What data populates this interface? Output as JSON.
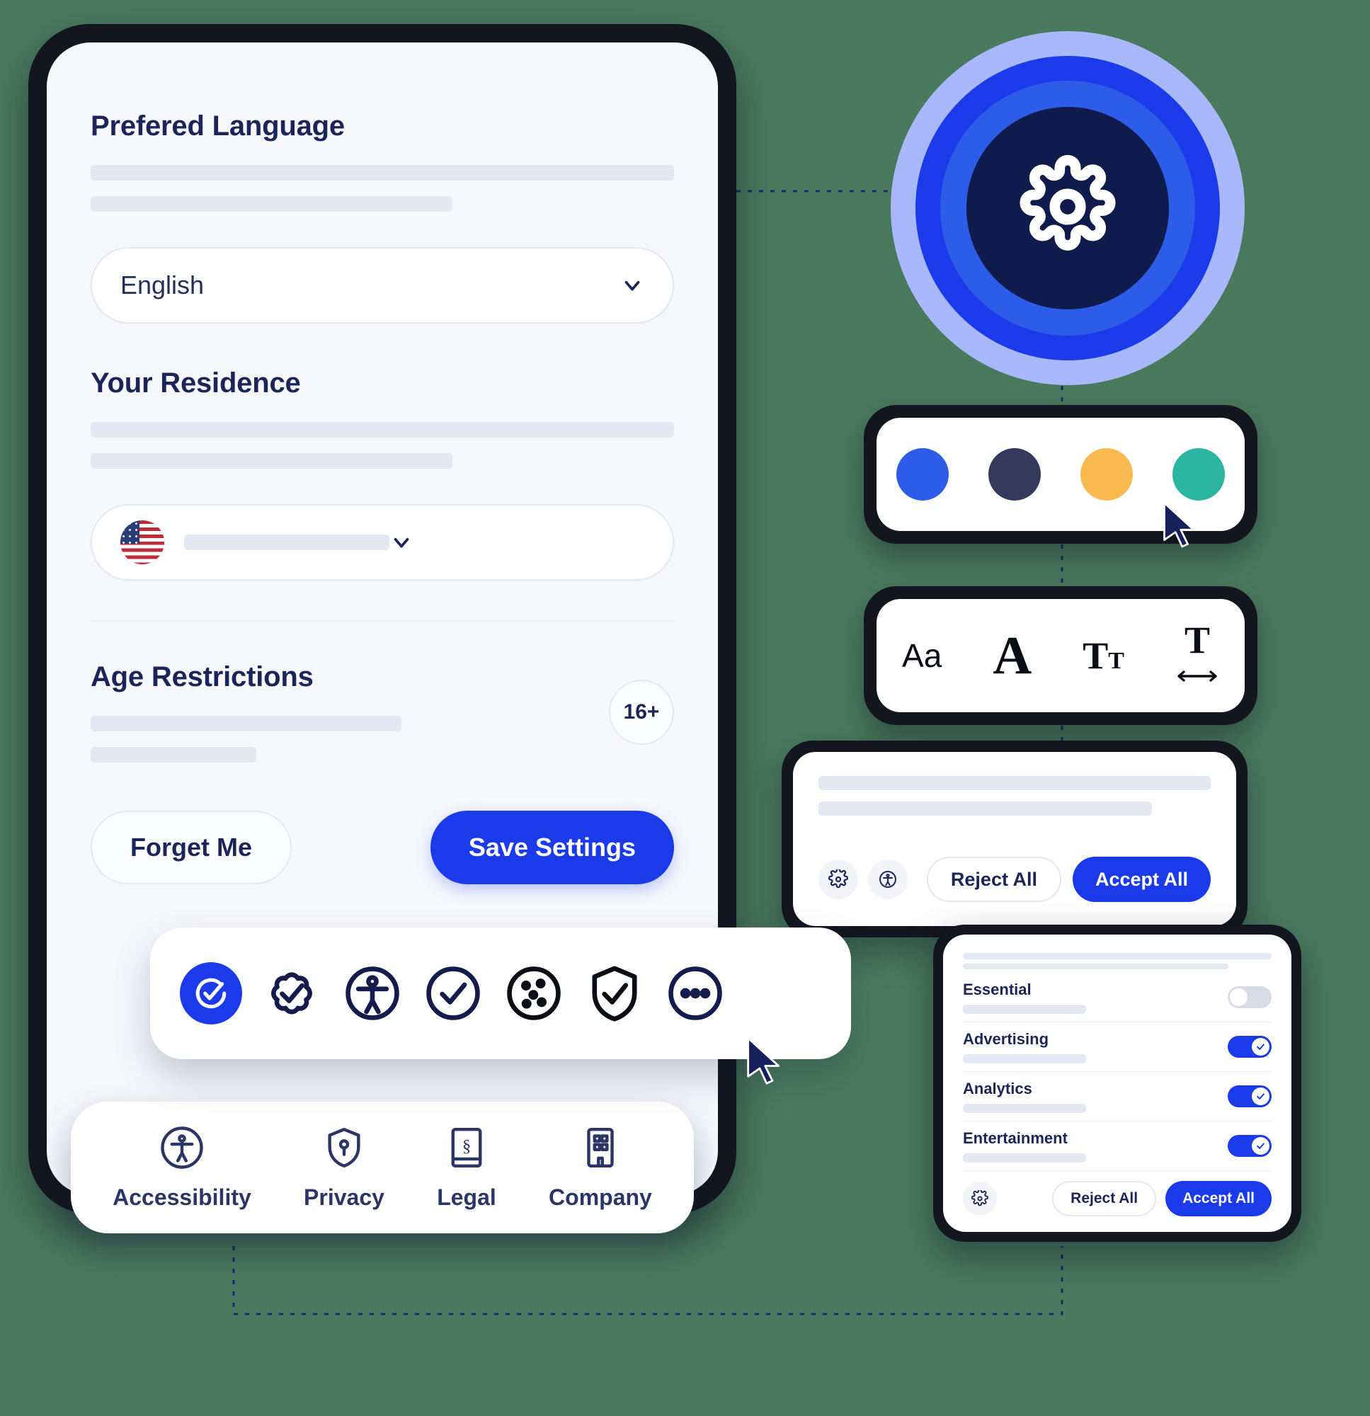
{
  "phone": {
    "language": {
      "heading": "Prefered Language",
      "selected": "English",
      "chevron_icon": "chevron-down-icon"
    },
    "residence": {
      "heading": "Your Residence",
      "flag_icon": "us-flag-icon",
      "chevron_icon": "chevron-down-icon"
    },
    "age": {
      "heading": "Age Restrictions",
      "badge": "16+"
    },
    "actions": {
      "forget": "Forget Me",
      "save": "Save Settings"
    }
  },
  "bottom_nav": {
    "items": [
      {
        "label": "Accessibility",
        "icon": "accessibility-person-icon"
      },
      {
        "label": "Privacy",
        "icon": "shield-keyhole-icon"
      },
      {
        "label": "Legal",
        "icon": "legal-book-icon"
      },
      {
        "label": "Company",
        "icon": "building-icon"
      }
    ]
  },
  "icon_toolbar": {
    "items": [
      {
        "icon": "check-circle-filled-icon",
        "active": true
      },
      {
        "icon": "badge-check-icon",
        "active": false
      },
      {
        "icon": "accessibility-circle-icon",
        "active": false
      },
      {
        "icon": "check-circle-icon",
        "active": false
      },
      {
        "icon": "cookie-icon",
        "active": false
      },
      {
        "icon": "shield-check-icon",
        "active": false
      },
      {
        "icon": "ellipsis-circle-icon",
        "active": false
      }
    ]
  },
  "logo": {
    "icon": "gear-icon",
    "ring_outer": "#a8b8fb",
    "ring_mid": "#1b3bea",
    "ring_inner": "#2d5ce8",
    "core": "#0f1b4c"
  },
  "color_picker": {
    "swatches": [
      {
        "name": "blue",
        "hex": "#2d5ce8"
      },
      {
        "name": "navy",
        "hex": "#333a5c"
      },
      {
        "name": "amber",
        "hex": "#f9b94e"
      },
      {
        "name": "teal",
        "hex": "#2cb5a0"
      }
    ],
    "cursor_icon": "mouse-cursor-icon"
  },
  "typography_bar": {
    "items": [
      {
        "label": "Aa",
        "name": "font-family-button"
      },
      {
        "label": "A",
        "name": "font-size-button"
      },
      {
        "label": "T",
        "sub": "T",
        "name": "text-case-button"
      },
      {
        "label": "T",
        "name": "letter-spacing-button"
      }
    ]
  },
  "consent_banner": {
    "gear_icon": "gear-icon",
    "accessibility_icon": "accessibility-person-icon",
    "reject": "Reject All",
    "accept": "Accept All"
  },
  "preferences_panel": {
    "rows": [
      {
        "name": "Essential",
        "enabled": false
      },
      {
        "name": "Advertising",
        "enabled": true
      },
      {
        "name": "Analytics",
        "enabled": true
      },
      {
        "name": "Entertainment",
        "enabled": true
      }
    ],
    "gear_icon": "gear-icon",
    "reject": "Reject All",
    "accept": "Accept All"
  },
  "accent": {
    "brand_blue": "#1b3bea",
    "ink": "#1b2559",
    "skeleton": "#e3e8f2"
  }
}
